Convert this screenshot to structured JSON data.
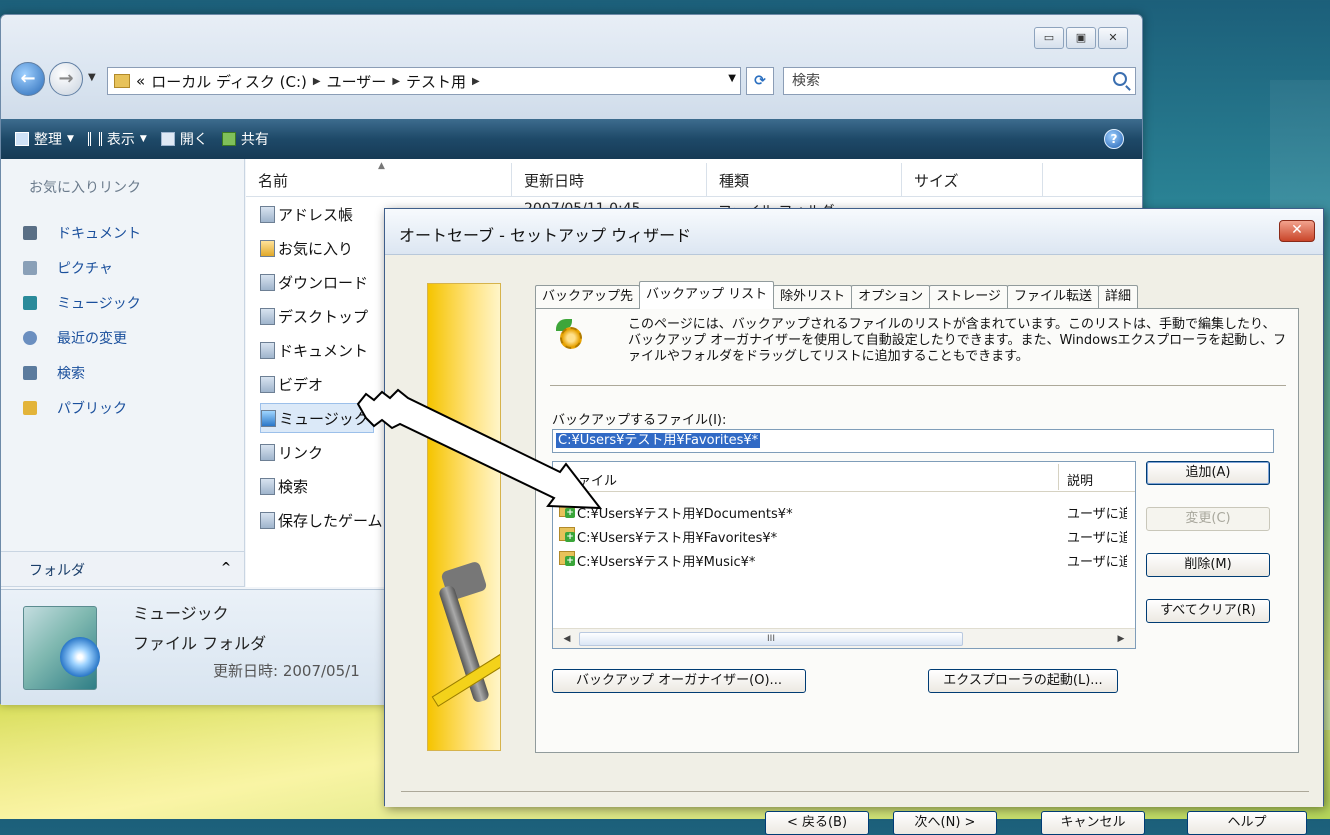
{
  "explorer": {
    "window_buttons": [
      "▭",
      "▣",
      "✕"
    ],
    "address": {
      "prefix": "«",
      "segments": [
        "ローカル ディスク (C:)",
        "ユーザー",
        "テスト用"
      ]
    },
    "search_placeholder": "検索",
    "toolbar": [
      {
        "label": "整理",
        "dropdown": true,
        "icon": "organize-icon"
      },
      {
        "label": "表示",
        "dropdown": true,
        "icon": "views-icon"
      },
      {
        "label": "開く",
        "dropdown": false,
        "icon": "open-icon"
      },
      {
        "label": "共有",
        "dropdown": false,
        "icon": "share-icon"
      }
    ],
    "help_label": "?",
    "favorites_heading": "お気に入りリンク",
    "favorites": [
      {
        "label": "ドキュメント",
        "icon": "documents-icon",
        "color": "#5a6f86"
      },
      {
        "label": "ピクチャ",
        "icon": "pictures-icon",
        "color": "#8aa0b8"
      },
      {
        "label": "ミュージック",
        "icon": "music-icon",
        "color": "#2a8a9a"
      },
      {
        "label": "最近の変更",
        "icon": "recent-icon",
        "color": "#6b8fc0"
      },
      {
        "label": "検索",
        "icon": "search-folder-icon",
        "color": "#5b7b9e"
      },
      {
        "label": "パブリック",
        "icon": "public-icon",
        "color": "#e3b43a"
      }
    ],
    "folders_label": "フォルダ",
    "folders_caret": "^",
    "columns": [
      "名前",
      "更新日時",
      "種類",
      "サイズ"
    ],
    "files": [
      "アドレス帳",
      "お気に入り",
      "ダウンロード",
      "デスクトップ",
      "ドキュメント",
      "ビデオ",
      "ミュージック",
      "リンク",
      "検索",
      "保存したゲーム"
    ],
    "first_row_date": "2007/05/11 0:45",
    "first_row_kind": "ファイル フォルダ",
    "details": {
      "name": "ミュージック",
      "kind": "ファイル フォルダ",
      "date": "更新日時: 2007/05/1"
    }
  },
  "wizard": {
    "title": "オートセーブ - セットアップ ウィザード",
    "close_label": "✕",
    "tabs": [
      "バックアップ先",
      "バックアップ リスト",
      "除外リスト",
      "オプション",
      "ストレージ",
      "ファイル転送",
      "詳細"
    ],
    "active_tab": 1,
    "intro_text": "このページには、バックアップされるファイルのリストが含まれています。このリストは、手動で編集したり、バックアップ オーガナイザーを使用して自動設定したりできます。また、Windowsエクスプローラを起動し、ファイルやフォルダをドラッグしてリストに追加することもできます。",
    "files_label": "バックアップするファイル(I):",
    "path_value": "C:¥Users¥テスト用¥Favorites¥*",
    "list_headers": [
      "ファイル",
      "説明"
    ],
    "list_rows": [
      {
        "path": "C:¥Users¥テスト用¥Documents¥*",
        "desc": "ユーザに追"
      },
      {
        "path": "C:¥Users¥テスト用¥Favorites¥*",
        "desc": "ユーザに追"
      },
      {
        "path": "C:¥Users¥テスト用¥Music¥*",
        "desc": "ユーザに追"
      }
    ],
    "scroll_thumb": "III",
    "buttons": {
      "add": "追加(A)",
      "change": "変更(C)",
      "delete": "削除(M)",
      "clear_all": "すべてクリア(R)",
      "organizer": "バックアップ オーガナイザー(O)...",
      "explorer": "エクスプローラの起動(L)...",
      "back": "< 戻る(B)",
      "next": "次へ(N) >",
      "cancel": "キャンセル",
      "help": "ヘルプ"
    }
  }
}
